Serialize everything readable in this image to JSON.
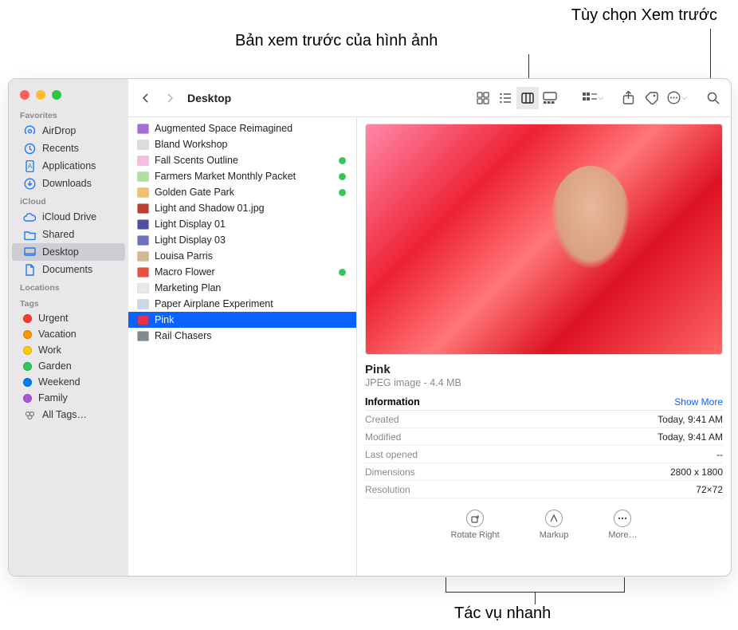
{
  "callouts": {
    "preview_options": "Tùy chọn Xem trước",
    "image_preview": "Bản xem trước của hình ảnh",
    "quick_actions": "Tác vụ nhanh"
  },
  "window": {
    "title": "Desktop"
  },
  "sidebar": {
    "sections": {
      "favorites": "Favorites",
      "icloud": "iCloud",
      "locations": "Locations",
      "tags": "Tags"
    },
    "favorites": [
      {
        "label": "AirDrop",
        "icon": "airdrop"
      },
      {
        "label": "Recents",
        "icon": "clock"
      },
      {
        "label": "Applications",
        "icon": "apps"
      },
      {
        "label": "Downloads",
        "icon": "download"
      }
    ],
    "icloud": [
      {
        "label": "iCloud Drive",
        "icon": "cloud"
      },
      {
        "label": "Shared",
        "icon": "folder"
      },
      {
        "label": "Desktop",
        "icon": "desktop",
        "selected": true
      },
      {
        "label": "Documents",
        "icon": "doc"
      }
    ],
    "tags": [
      {
        "label": "Urgent",
        "color": "#ff3b30"
      },
      {
        "label": "Vacation",
        "color": "#ff9500"
      },
      {
        "label": "Work",
        "color": "#ffcc00"
      },
      {
        "label": "Garden",
        "color": "#34c759"
      },
      {
        "label": "Weekend",
        "color": "#007aff"
      },
      {
        "label": "Family",
        "color": "#af52de"
      }
    ],
    "all_tags": "All Tags…"
  },
  "files": [
    {
      "label": "Augmented Space Reimagined",
      "color": "#a56bd6"
    },
    {
      "label": "Bland Workshop",
      "color": "#dcdcdc"
    },
    {
      "label": "Fall Scents Outline",
      "color": "#f5bde0",
      "tag": true
    },
    {
      "label": "Farmers Market Monthly Packet",
      "color": "#b0e0a0",
      "tag": true
    },
    {
      "label": "Golden Gate Park",
      "color": "#f0c070",
      "tag": true
    },
    {
      "label": "Light and Shadow 01.jpg",
      "color": "#c04030"
    },
    {
      "label": "Light Display 01",
      "color": "#5050a0"
    },
    {
      "label": "Light Display 03",
      "color": "#7070c0"
    },
    {
      "label": "Louisa Parris",
      "color": "#d4b896"
    },
    {
      "label": "Macro Flower",
      "color": "#e85040",
      "tag": true
    },
    {
      "label": "Marketing Plan",
      "color": "#e8e8e8"
    },
    {
      "label": "Paper Airplane Experiment",
      "color": "#c8d8e8"
    },
    {
      "label": "Pink",
      "color": "#e83050",
      "selected": true
    },
    {
      "label": "Rail Chasers",
      "color": "#808890"
    }
  ],
  "preview": {
    "name": "Pink",
    "type": "JPEG image - 4.4 MB",
    "info_header": "Information",
    "show_more": "Show More",
    "info": [
      {
        "k": "Created",
        "v": "Today, 9:41 AM"
      },
      {
        "k": "Modified",
        "v": "Today, 9:41 AM"
      },
      {
        "k": "Last opened",
        "v": "--"
      },
      {
        "k": "Dimensions",
        "v": "2800 x 1800"
      },
      {
        "k": "Resolution",
        "v": "72×72"
      }
    ],
    "actions": [
      {
        "label": "Rotate Right",
        "icon": "rotate"
      },
      {
        "label": "Markup",
        "icon": "markup"
      },
      {
        "label": "More…",
        "icon": "more"
      }
    ]
  }
}
